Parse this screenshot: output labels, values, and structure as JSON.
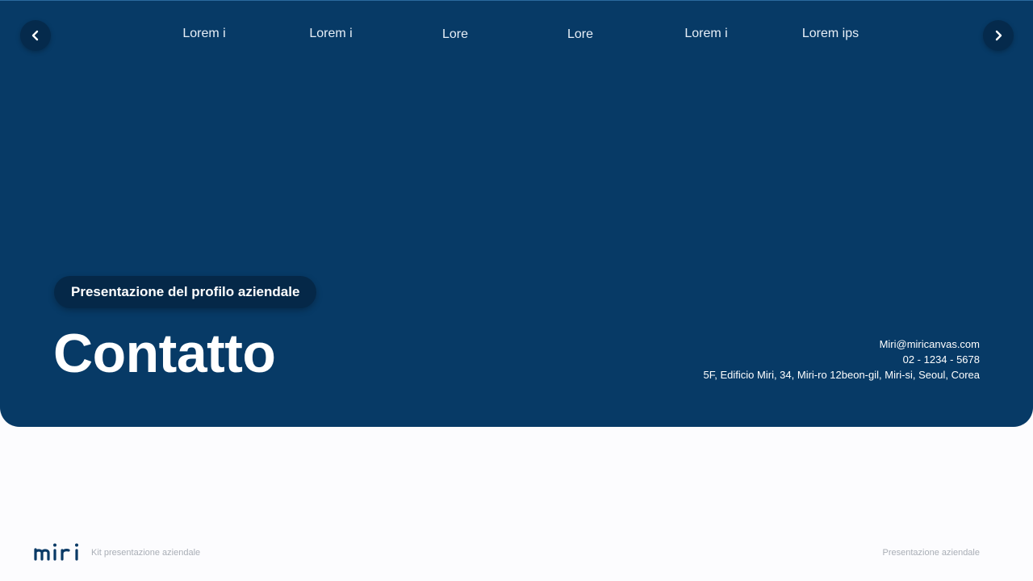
{
  "colors": {
    "hero_background": "#073a66",
    "nav_button": "#052a4c",
    "pill_background": "#052848",
    "text_light": "#ffffff",
    "footer_text": "#a9aeb6",
    "logo": "#0a3a66"
  },
  "nav": {
    "prev_icon": "chevron-left-icon",
    "next_icon": "chevron-right-icon",
    "tabs": [
      {
        "label": "Lorem i"
      },
      {
        "label": "Lorem i"
      },
      {
        "label": "Lore"
      },
      {
        "label": "Lore"
      },
      {
        "label": "Lorem i"
      },
      {
        "label": "Lorem ips"
      }
    ]
  },
  "hero": {
    "pill_label": "Presentazione del profilo aziendale",
    "title": "Contatto",
    "contact": {
      "email": "Miri@miricanvas.com",
      "phone": "02 - 1234 - 5678",
      "address": "5F, Edificio Miri, 34, Miri-ro 12beon-gil, Miri-si, Seoul, Corea"
    }
  },
  "footer": {
    "logo_text": "miri",
    "left_text": "Kit presentazione aziendale",
    "right_text": "Presentazione aziendale"
  }
}
